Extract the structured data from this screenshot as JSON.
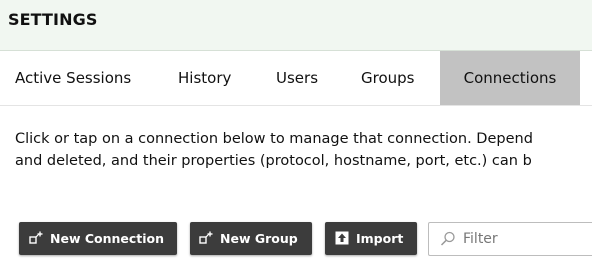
{
  "header": {
    "title": "SETTINGS"
  },
  "tabs": [
    {
      "label": "Active Sessions",
      "active": false
    },
    {
      "label": "History",
      "active": false
    },
    {
      "label": "Users",
      "active": false
    },
    {
      "label": "Groups",
      "active": false
    },
    {
      "label": "Connections",
      "active": true
    }
  ],
  "description": {
    "line1": "Click or tap on a connection below to manage that connection. Depend",
    "line2": "and deleted, and their properties (protocol, hostname, port, etc.) can b"
  },
  "toolbar": {
    "new_connection_label": "New Connection",
    "new_group_label": "New Group",
    "import_label": "Import",
    "filter_placeholder": "Filter",
    "filter_value": ""
  },
  "icons": {
    "new_connection": "add-connection-icon",
    "new_group": "add-group-icon",
    "import": "upload-icon",
    "filter": "search-icon"
  },
  "colors": {
    "header_bg": "#f1f7f1",
    "active_tab_bg": "#c2c2c2",
    "button_bg": "#3c3c3c",
    "button_text": "#ffffff"
  }
}
